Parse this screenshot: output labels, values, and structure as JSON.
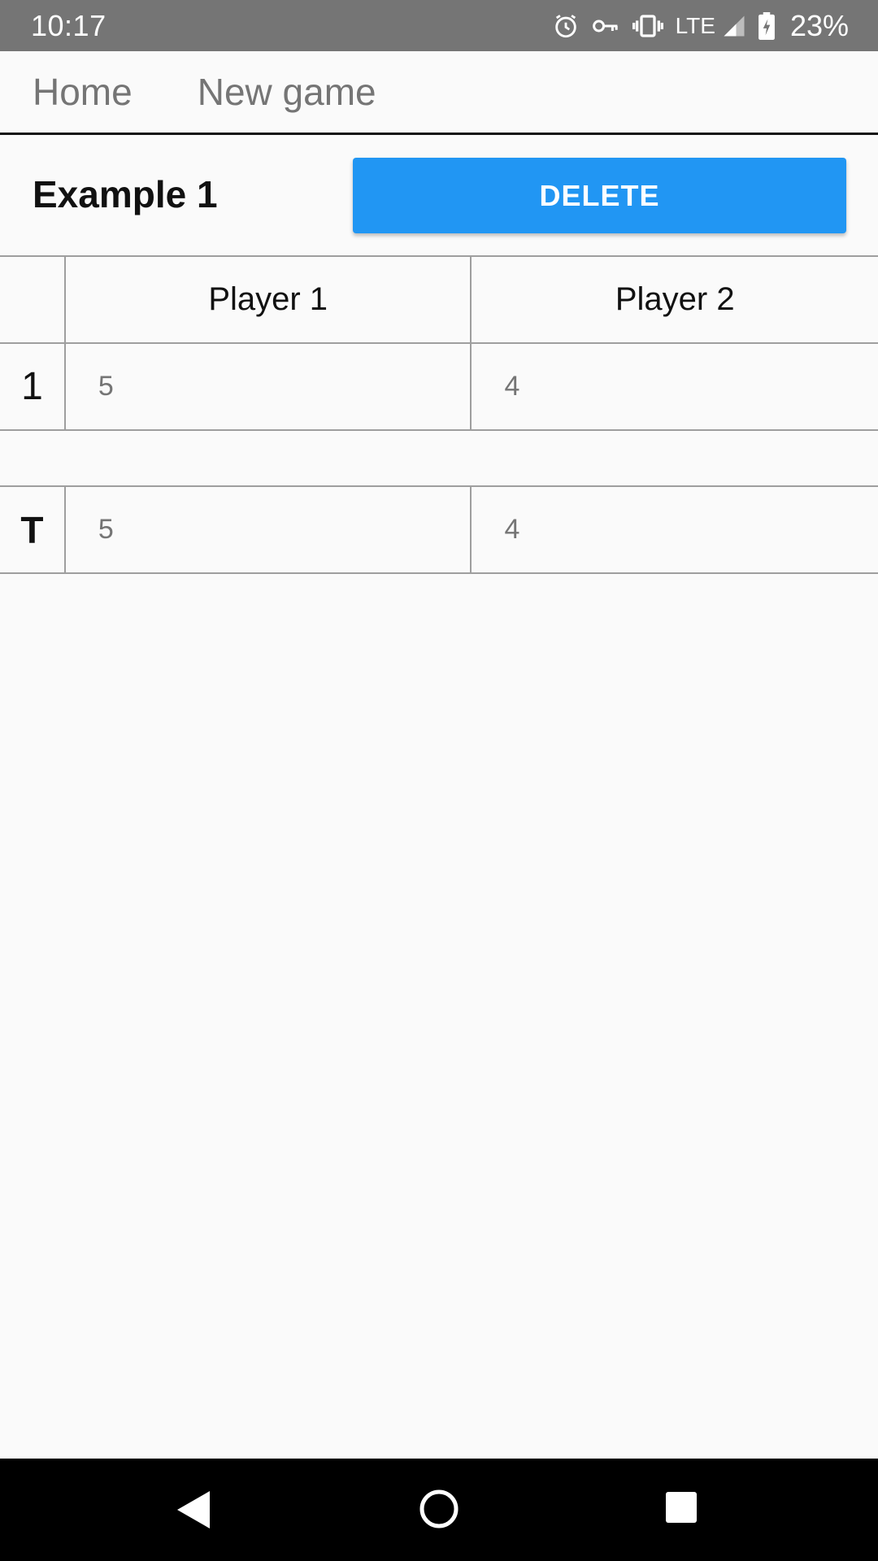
{
  "status_bar": {
    "time": "10:17",
    "network": "LTE",
    "battery": "23%",
    "icons": [
      "alarm-icon",
      "vpn-key-icon",
      "vibrate-icon",
      "signal-icon",
      "battery-charging-icon"
    ]
  },
  "nav": {
    "home": "Home",
    "new_game": "New game"
  },
  "game": {
    "title": "Example 1",
    "delete_label": "DELETE"
  },
  "table": {
    "players": [
      "Player 1",
      "Player 2"
    ],
    "rounds": [
      {
        "index": "1",
        "scores": [
          "5",
          "4"
        ]
      }
    ],
    "total": {
      "label": "T",
      "scores": [
        "5",
        "4"
      ]
    }
  },
  "colors": {
    "accent": "#2196f3",
    "status_bar": "#757575",
    "background": "#fafafa",
    "grid_line": "#9e9e9e"
  },
  "system_nav": {
    "icons": [
      "back-icon",
      "home-icon",
      "recents-icon"
    ]
  }
}
